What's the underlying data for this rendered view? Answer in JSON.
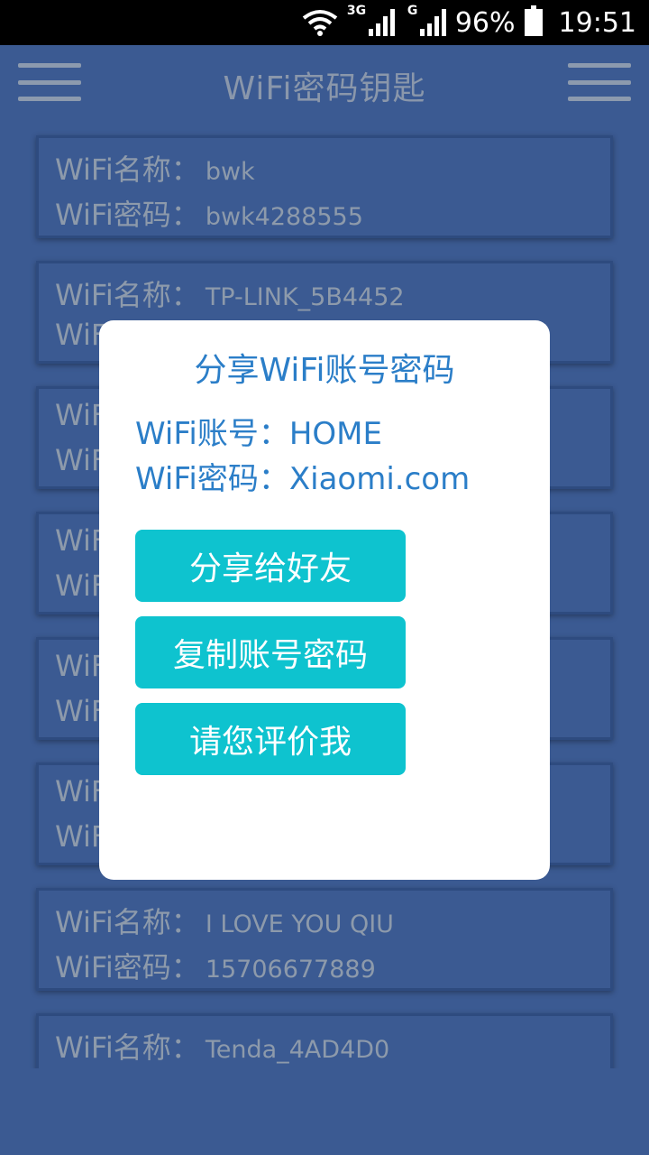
{
  "status_bar": {
    "network1": "3G",
    "network2": "G",
    "battery": "96%",
    "time": "19:51"
  },
  "header": {
    "title": "WiFi密码钥匙"
  },
  "wifi_list": [
    {
      "name_label": "WiFi名称：",
      "name": "bwk",
      "pass_label": "WiFi密码：",
      "password": "bwk4288555"
    },
    {
      "name_label": "WiFi名称：",
      "name": "TP-LINK_5B4452",
      "pass_label": "WiF",
      "password": ""
    },
    {
      "name_label": "WiF",
      "name": "",
      "pass_label": "WiF",
      "password": ""
    },
    {
      "name_label": "WiF",
      "name": "",
      "pass_label": "WiF",
      "password": ""
    },
    {
      "name_label": "WiF",
      "name": "",
      "pass_label": "WiF",
      "password": ""
    },
    {
      "name_label": "WiF",
      "name": "",
      "pass_label": "WiF",
      "password": ""
    },
    {
      "name_label": "WiFi名称：",
      "name": "I LOVE YOU QIU",
      "pass_label": "WiFi密码：",
      "password": "15706677889"
    },
    {
      "name_label": "WiFi名称：",
      "name": "Tenda_4AD4D0",
      "pass_label": "",
      "password": ""
    }
  ],
  "dialog": {
    "title": "分享WiFi账号密码",
    "account_line": "WiFi账号：HOME",
    "password_line": "WiFi密码：Xiaomi.com",
    "buttons": {
      "share": "分享给好友",
      "copy": "复制账号密码",
      "rate": "请您评价我"
    }
  },
  "colors": {
    "background": "#3b5a92",
    "dialog_text": "#2b7ec8",
    "button": "#0ec3cf",
    "list_text": "#8d9aab"
  }
}
